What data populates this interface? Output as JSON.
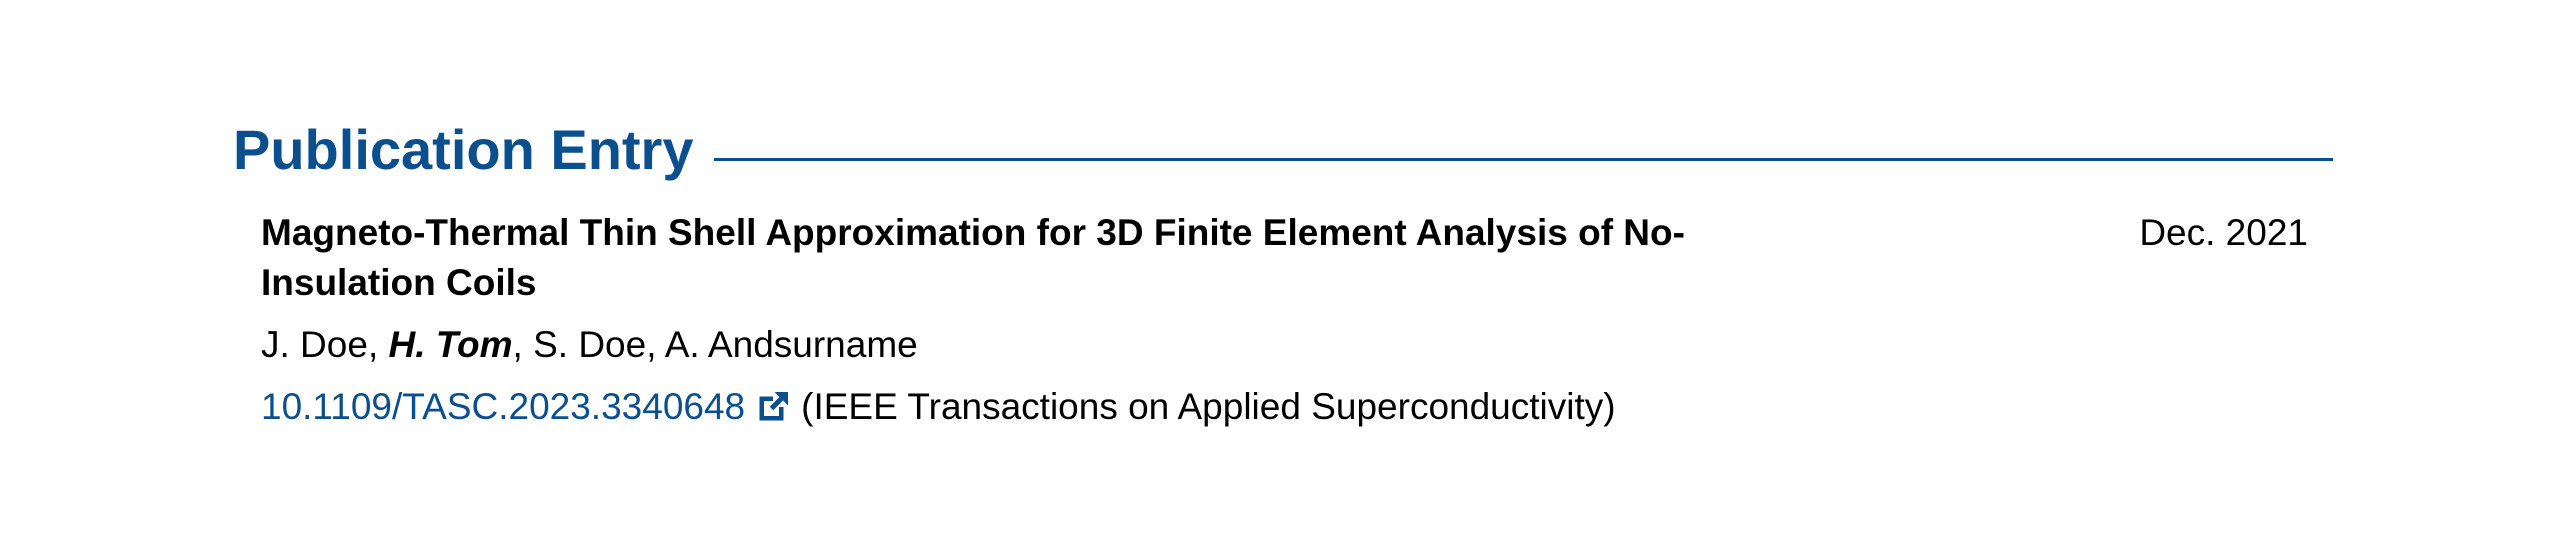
{
  "section": {
    "title": "Publication Entry"
  },
  "entry": {
    "title": "Magneto-Thermal Thin Shell Approximation for 3D Finite Element Analysis of No-Insulation Coils",
    "date": "Dec. 2021",
    "authors": [
      {
        "name": "J. Doe",
        "highlight": false
      },
      {
        "name": "H. Tom",
        "highlight": true
      },
      {
        "name": "S. Doe",
        "highlight": false
      },
      {
        "name": "A. Andsurname",
        "highlight": false
      }
    ],
    "author_separator": ", ",
    "doi": "10.1109/TASC.2023.3340648",
    "venue": "(IEEE Transactions on Applied Superconductivity)",
    "link_icon": "external-link-icon"
  },
  "colors": {
    "accent": "#0b4f8f",
    "text": "#000000",
    "background": "#ffffff"
  }
}
